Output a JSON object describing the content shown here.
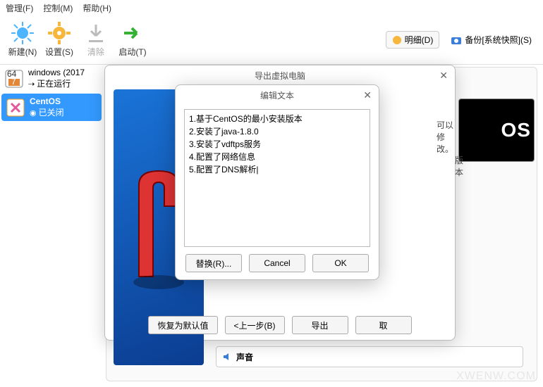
{
  "menu": {
    "manage": "管理(F)",
    "control": "控制(M)",
    "help": "帮助(H)"
  },
  "toolbar": {
    "new": "新建(N)",
    "settings": "设置(S)",
    "clear": "清除",
    "start": "启动(T)",
    "detail": "明细(D)",
    "snapshot": "备份[系统快照](S)"
  },
  "vms": [
    {
      "name": "windows (2017",
      "status": "正在运行"
    },
    {
      "name": "CentOS",
      "status": "已关闭"
    }
  ],
  "details_hint": "可以修改。",
  "details_hint2": "版本",
  "sound_section": "声音",
  "preview_text": "OS",
  "export_dialog": {
    "title": "导出虚拟电脑",
    "buttons": {
      "reset": "恢复为默认值",
      "back": "<上一步(B)",
      "export": "导出",
      "cancel": "取"
    }
  },
  "edit_dialog": {
    "title": "编辑文本",
    "text": "1.基于CentOS的最小安装版本\n2.安装了java-1.8.0\n3.安装了vdftps服务\n4.配置了网络信息\n5.配置了DNS解析|",
    "buttons": {
      "replace": "替换(R)...",
      "cancel": "Cancel",
      "ok": "OK"
    }
  },
  "watermark": "XWENW.COM"
}
